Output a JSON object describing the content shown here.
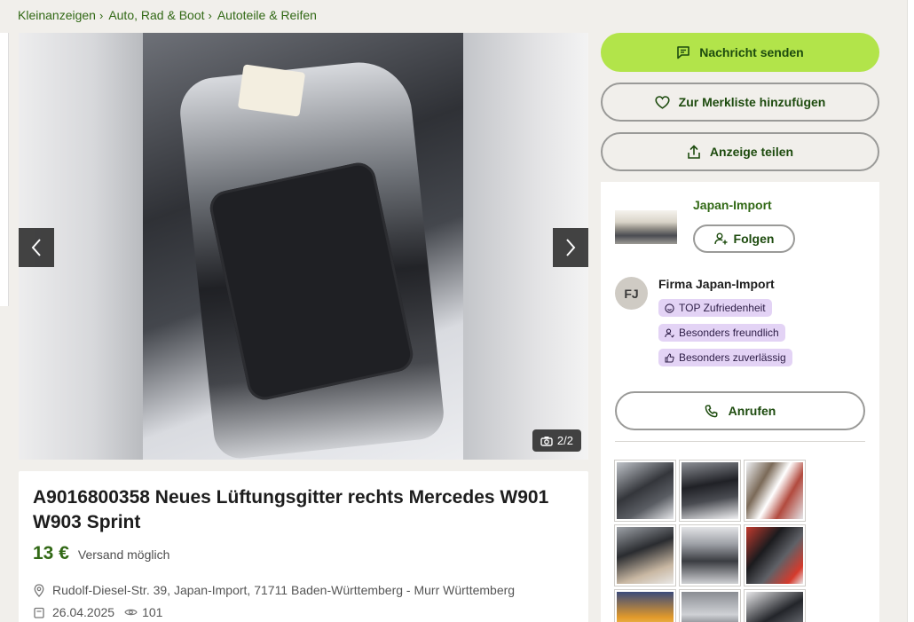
{
  "breadcrumb": [
    {
      "label": "Kleinanzeigen",
      "sep": "›"
    },
    {
      "label": "Auto, Rad & Boot",
      "sep": "›"
    },
    {
      "label": "Autoteile & Reifen",
      "sep": ""
    }
  ],
  "gallery": {
    "counter": "2/2",
    "prev_icon": "chevron-left-icon",
    "next_icon": "chevron-right-icon",
    "camera_icon": "camera-icon"
  },
  "listing": {
    "title": "A9016800358 Neues Lüftungsgitter rechts Mercedes W901 W903 Sprint",
    "price": "13 €",
    "shipping": "Versand möglich",
    "location": "Rudolf-Diesel-Str. 39, Japan-Import, 71711 Baden-Württemberg - Murr Württemberg",
    "date": "26.04.2025",
    "views": "101"
  },
  "actions": {
    "message": "Nachricht senden",
    "watchlist": "Zur Merkliste hinzufügen",
    "share": "Anzeige teilen"
  },
  "seller": {
    "shop_name": "Japan-Import",
    "follow": "Folgen",
    "avatar_initials": "FJ",
    "firm_name": "Firma Japan-Import",
    "badges": [
      "TOP Zufriedenheit",
      "Besonders freundlich",
      "Besonders zuverlässig"
    ],
    "call": "Anrufen"
  },
  "colors": {
    "primary_button": "#b2e44a",
    "brand_green": "#326916",
    "badge_bg": "#e3d3f5"
  }
}
